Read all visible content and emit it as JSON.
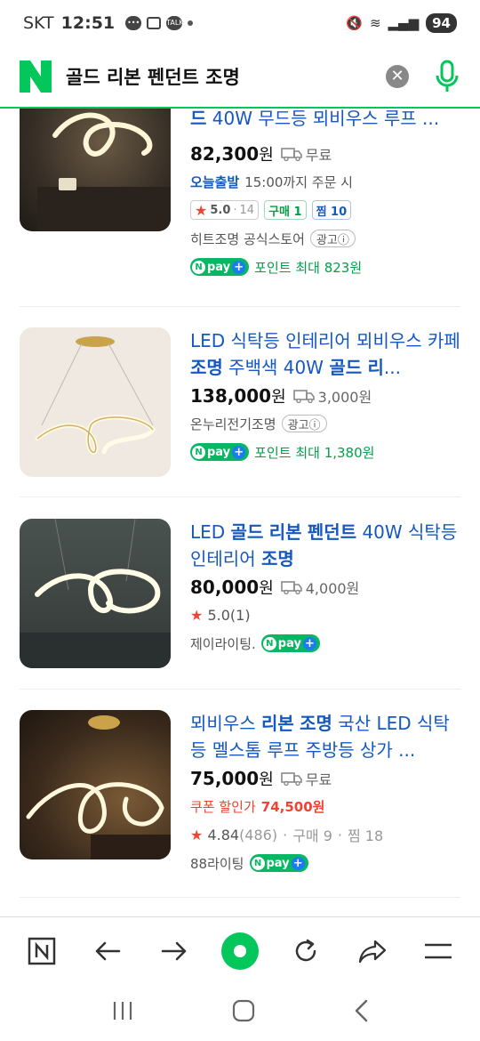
{
  "status_bar": {
    "carrier": "SKT",
    "time": "12:51",
    "notif_talk": "TALK",
    "battery": "94"
  },
  "search": {
    "query": "골드 리본 펜던트 조명",
    "clear_label": "✕"
  },
  "colors": {
    "naver_green": "#03c75a",
    "title_blue": "#1558c0",
    "coupon_red": "#e43c2f"
  },
  "results": [
    {
      "title_parts": [
        "드",
        " 40W 무드등 뫼비우스 루프 ..."
      ],
      "price": "82,300",
      "won": "원",
      "shipping": "무료",
      "today_label": "오늘출발",
      "today_text": "15:00까지 주문 시",
      "rating": "5.0",
      "reviews": "14",
      "buy_label": "구매 1",
      "zzim_label": "찜 10",
      "store": "히트조명 공식스토어",
      "ad_label": "광고ⓘ",
      "npay_label": "pay",
      "point": "포인트 최대 823원"
    },
    {
      "title_parts": [
        "LED 식탁등 인테리어 뫼비우스 카페 ",
        "조명",
        " 주백색 40W ",
        "골드",
        " ",
        "리",
        "..."
      ],
      "price": "138,000",
      "won": "원",
      "shipping": "3,000원",
      "store": "온누리전기조명",
      "ad_label": "광고ⓘ",
      "npay_label": "pay",
      "point": "포인트 최대 1,380원"
    },
    {
      "title_parts": [
        "LED ",
        "골드",
        " ",
        "리본",
        " ",
        "펜던트",
        " 40W 식탁등 인테리어 ",
        "조명"
      ],
      "price": "80,000",
      "won": "원",
      "shipping": "4,000원",
      "rating": "5.0",
      "reviews": "(1)",
      "store": "제이라이팅.",
      "npay_label": "pay"
    },
    {
      "title_parts": [
        "뫼비우스 ",
        "리본",
        " ",
        "조명",
        " 국산 LED 식탁등 멜스톰 루프 주방등 상가 ..."
      ],
      "price": "75,000",
      "won": "원",
      "shipping": "무료",
      "coupon_label": "쿠폰 할인가",
      "coupon_price": "74,500원",
      "rating": "4.84",
      "reviews": "(486)",
      "buy_label": "구매 9",
      "zzim_label": "찜 18",
      "store": "88라이팅",
      "npay_label": "pay"
    }
  ],
  "toolbar": [
    "naver-home",
    "back",
    "forward",
    "green-dot",
    "refresh",
    "share",
    "menu"
  ],
  "sysnav": [
    "recents",
    "home",
    "back"
  ]
}
